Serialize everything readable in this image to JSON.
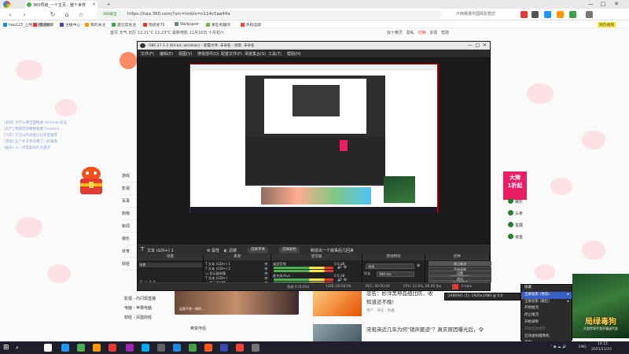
{
  "browser": {
    "tabs": [
      {
        "label": "360导航_一个主页，整个世界",
        "active": true,
        "color": "#4caf50"
      },
      {
        "label": "新标签页",
        "active": false,
        "color": "#e0e0e0"
      }
    ],
    "new_tab": "+",
    "url": "https://hao.360.com/?src=lm&ls=n114c5aa49a",
    "secure_badge": "360安全",
    "search_hint": "卢西赛遭中国网友怒怼",
    "window_controls": [
      "—",
      "□",
      "✕"
    ],
    "bookmarks": [
      "hao123_上网从这里开始",
      "有道翻译",
      "主播中心",
      "我的关注",
      "遇见其他话",
      "南极星70",
      "Wallpaper-",
      "哪些有趣的",
      "热榜追踪"
    ],
    "side_badge": "网页视频"
  },
  "page": {
    "nav_row": "首页  天气  日历   12-21°C  12-23°C  最新电影  11月16日  十月初六",
    "nav_right": [
      "双十精灵",
      "隐私",
      "切换",
      "反馈",
      "帮助"
    ],
    "left_links": [
      "[新闻] 为什么要全面推进 Unicode 标准",
      "[房产] 特朗普的精致套路 Freshers...",
      "[汽车] 万元以内高性价比车型推荐",
      "[游戏] 这个冬天你去哪了一起来看",
      "[娱乐] 十一月电影新片大盘点"
    ],
    "sidebar_items": [
      "游戏",
      "影视",
      "军事",
      "购物",
      "新闻",
      "娱乐",
      "体育",
      "财经"
    ],
    "sidebar_bottom": [
      "影视 - 内闪现直播",
      "电脑 - 苹果电脑",
      "财经 - 凤凰财经"
    ],
    "ad_big": "大牌",
    "ad_big2": "1折起",
    "right_links": [
      "娱乐",
      "头条",
      "发展",
      "资金"
    ],
    "news": [
      {
        "title": "忠告：妙洋黑帮品组比防，收",
        "tail": "知道还不晚!",
        "meta": "用户 · 评论 · 热播"
      },
      {
        "title": "宋祖英近几年为何\"销声匿迹\"？真实原因曝光后，令",
        "meta": ""
      }
    ],
    "banner_caption": "运营不到一周的...",
    "below_banner": "英俊伴侣"
  },
  "obs": {
    "title": "OBS 27.1.3 (64-bit, windows) - 配置文件: 未命名 - 场景: 未命名",
    "menu": [
      "文件(F)",
      "编辑(E)",
      "视图(V)",
      "停靠部件(D)",
      "配置文件(P)",
      "场景集合(S)",
      "工具(T)",
      "帮助(H)"
    ],
    "toolbar": {
      "source_label": "文本 (GDI+) 1",
      "properties": "属性",
      "filters": "滤镜",
      "select_font": "选择字体",
      "select_color": "选择颜色",
      "hint": "制造出一个故事后几回来"
    },
    "docks": {
      "scenes": {
        "title": "场景",
        "items": [
          "场景"
        ]
      },
      "sources": {
        "title": "来源",
        "items": [
          "文本 (GDI+) 1",
          "文本 (GDI+) 2",
          "显示器采集",
          "文本 (GDI+)",
          "显示器采集"
        ]
      },
      "mixer": {
        "title": "混音器",
        "tracks": [
          {
            "name": "桌面音频",
            "db": "0.0 dB"
          },
          {
            "name": "麦克风/Aux",
            "db": "0.0 dB"
          }
        ]
      },
      "transitions": {
        "title": "转场特效",
        "type": "淡出",
        "duration_label": "时长",
        "duration": "300 ms"
      },
      "controls": {
        "title": "控件",
        "buttons": [
          "停止推流",
          "开始录制",
          "启动虚拟摄像机",
          "工作室模式",
          "设置",
          "退出"
        ]
      }
    },
    "status": {
      "drop": "丢帧 0 (0.0%)",
      "live": "LIVE: 00:00:00",
      "rec": "REC: 00:00:00",
      "cpu": "CPU: 12.8%, 60.00 fps",
      "kbps": "0 kb/s"
    }
  },
  "context_menu": {
    "items": [
      {
        "label": "隐藏",
        "state": "normal"
      },
      {
        "label": "全屏投影 (预览)",
        "state": "highlight",
        "submenu": true
      },
      {
        "label": "全屏投影 (输出)",
        "state": "normal",
        "submenu": true
      },
      {
        "label": "开始推流",
        "state": "normal"
      },
      {
        "label": "停止推流",
        "state": "normal"
      },
      {
        "label": "开始录制",
        "state": "normal"
      },
      {
        "label": "开始回放缓存",
        "state": "disabled"
      },
      {
        "label": "启动虚拟摄像机",
        "state": "normal"
      },
      {
        "label": "退出",
        "state": "normal"
      }
    ],
    "submenu": {
      "label": "2480W1 (1): 1920x1080 @ 0,0"
    }
  },
  "game_ad": {
    "title": "局绿毒狗",
    "subtitle": "大型传奇手游开服送代金"
  },
  "taskbar": {
    "apps": [
      "#ffffff",
      "#2196f3",
      "#4caf50",
      "#ff9800",
      "#e53935",
      "#9c27b0",
      "#03a9f4",
      "#616161",
      "#1e88e5",
      "#43a047",
      "#ff5722",
      "#3949ab",
      "#f44336",
      "#757575"
    ],
    "tray_text": "ENG",
    "time": "14:15",
    "date": "2021/11/10"
  },
  "colors": {
    "obs_bg": "#2b2b2b",
    "highlight": "#3a5fc4",
    "recording_red": "#e53935"
  }
}
